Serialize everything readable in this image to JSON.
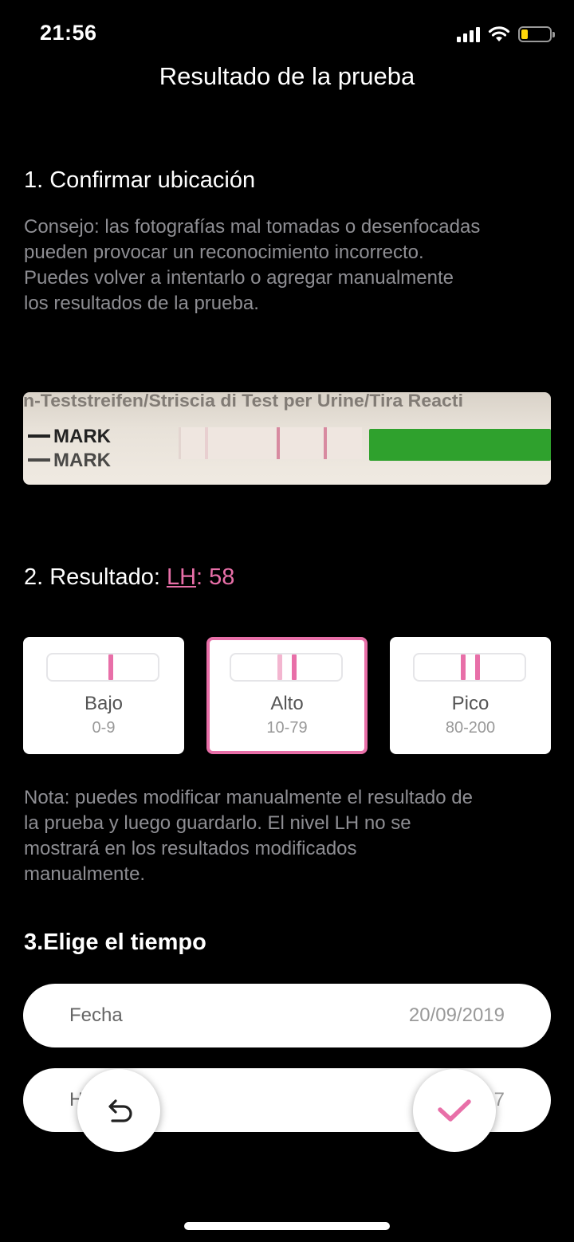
{
  "status_bar": {
    "time": "21:56",
    "icons": [
      "signal-icon",
      "wifi-icon",
      "battery-icon"
    ]
  },
  "header": {
    "title": "Resultado de la prueba"
  },
  "step1": {
    "heading": "1. Confirmar ubicación",
    "tip_lines": [
      "Consejo: las fotografías mal tomadas o desenfocadas",
      "pueden provocar un reconocimiento incorrecto.",
      "Puedes volver a intentarlo o agregar manualmente",
      "los resultados de la prueba."
    ],
    "strip_photo": {
      "top_text": "n-Teststreifen/Striscia di Test per Urine/Tira Reacti",
      "mark_label": "MARK",
      "mark_label_partial": "MARK"
    }
  },
  "step2": {
    "heading_prefix": "2. Resultado: ",
    "lh_link": "LH",
    "lh_suffix": ": 58",
    "levels": [
      {
        "name": "Bajo",
        "range": "0-9",
        "selected": false
      },
      {
        "name": "Alto",
        "range": "10-79",
        "selected": true
      },
      {
        "name": "Pico",
        "range": "80-200",
        "selected": false
      }
    ],
    "note_lines": [
      "Nota: puedes modificar manualmente el resultado de",
      "la prueba y luego guardarlo. El nivel LH no se",
      "mostrará en los resultados modificados",
      "manualmente."
    ]
  },
  "step3": {
    "heading": "3.Elige el tiempo",
    "date_label": "Fecha",
    "date_value": "20/09/2019",
    "time_label_partial": "H",
    "time_value_partial": "7"
  },
  "actions": {
    "undo_icon": "undo-icon",
    "confirm_icon": "check-icon"
  },
  "colors": {
    "accent": "#e86fa8",
    "background": "#000000",
    "card": "#ffffff",
    "muted_text": "#8e8e93"
  }
}
